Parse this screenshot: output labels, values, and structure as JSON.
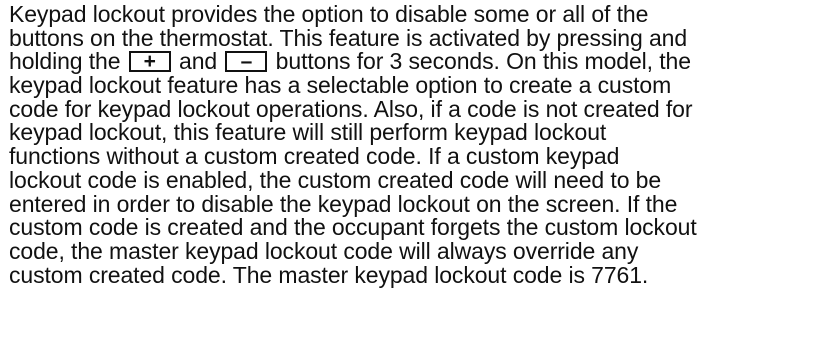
{
  "paragraph": {
    "line1": "Keypad lockout provides the option to disable some or all of the",
    "line2": "buttons on the thermostat.  This feature is activated by pressing and",
    "line3_a": "holding the ",
    "plus_key": "+",
    "line3_b": " and ",
    "minus_key": "–",
    "line3_c": " buttons for 3 seconds.  On this model, the",
    "line4": "keypad lockout feature has a selectable option to create a custom",
    "line5": "code for keypad lockout operations.  Also, if a code is not created for",
    "line6": "keypad lockout, this feature will still perform keypad lockout",
    "line7": "functions without a custom created code.  If a custom keypad",
    "line8": "lockout code is enabled, the custom created code will need to be",
    "line9": "entered in order to disable the keypad lockout on the screen.  If the",
    "line10": "custom code is created and the occupant forgets the custom lockout",
    "line11": "code, the master keypad lockout code will always override any",
    "line12": "custom created code. The master keypad lockout code is 7761."
  }
}
